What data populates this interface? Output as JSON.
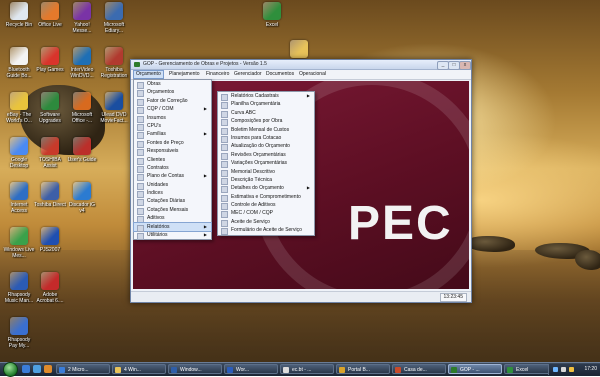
{
  "desktop": {
    "icons": [
      {
        "label": "Recycle Bin",
        "icon": "recycle-bin-icon",
        "color": "#dfe7ef"
      },
      {
        "label": "Office Live",
        "icon": "office-live-icon",
        "color": "#e4792b"
      },
      {
        "label": "Yahoo! Messe...",
        "icon": "yahoo-messenger-icon",
        "color": "#7a33a6"
      },
      {
        "label": "Microsoft Ediary...",
        "icon": "microsoft-ediary-icon",
        "color": "#3b6bb0"
      },
      {
        "label": "Bluetooth Guide Bo...",
        "icon": "bluetooth-icon",
        "color": "#f3f3f3"
      },
      {
        "label": "Play Games",
        "icon": "play-games-icon",
        "color": "#d9342b"
      },
      {
        "label": "InterVideo WinDVD...",
        "icon": "windvd-icon",
        "color": "#1e6fb5"
      },
      {
        "label": "Toshiba Registration",
        "icon": "toshiba-registration-icon",
        "color": "#b13a2f"
      },
      {
        "label": "eBay - The World's O...",
        "icon": "ebay-icon",
        "color": "#e9c43c"
      },
      {
        "label": "Software Upgrades",
        "icon": "software-upgrades-icon",
        "color": "#2d8a3d"
      },
      {
        "label": "Microsoft Office -...",
        "icon": "ms-office-icon",
        "color": "#d86a1f"
      },
      {
        "label": "Ulead DVD MovieFact...",
        "icon": "ulead-icon",
        "color": "#1a4ea0"
      },
      {
        "label": "Google Desktop",
        "icon": "google-desktop-icon",
        "color": "#4a8af4"
      },
      {
        "label": "TOSHIBA Assist",
        "icon": "toshiba-assist-icon",
        "color": "#c83a2a"
      },
      {
        "label": "User's Guide",
        "icon": "users-guide-icon",
        "color": "#bb2f2a"
      },
      {
        "label": "Internet Access",
        "icon": "internet-access-icon",
        "color": "#2e6ec4"
      },
      {
        "label": "Toshiba Direct",
        "icon": "toshiba-direct-icon",
        "color": "#3d5fa8"
      },
      {
        "label": "Discador iG v4",
        "icon": "discador-icon",
        "color": "#2b7bd1"
      },
      {
        "label": "Windows Live Mes...",
        "icon": "windows-live-messenger-icon",
        "color": "#3aa14a"
      },
      {
        "label": "PJS2007",
        "icon": "pjs2007-icon",
        "color": "#1f4fb1"
      },
      {
        "label": "Rhapsody Music Man...",
        "icon": "rhapsody-icon",
        "color": "#2b5bb5"
      },
      {
        "label": "Adobe Acrobat 6....",
        "icon": "adobe-acrobat-icon",
        "color": "#c42a2a"
      },
      {
        "label": "Rhapsody Pay My...",
        "icon": "rhapsody-pay-icon",
        "color": "#3a6fd0"
      },
      {
        "label": "Excel",
        "icon": "excel-icon",
        "color": "#2f8f3c"
      },
      {
        "label": "GOP",
        "icon": "folder-icon",
        "color": "#e8c35a"
      }
    ]
  },
  "window": {
    "title": "GOP - Gerenciamento de Obras e Projetos - Versão 1.5",
    "minimize": "_",
    "maximize": "□",
    "close": "x",
    "menus": [
      "Orçamento",
      "Planejamento",
      "Financeiro",
      "Gerenciador",
      "Documentos",
      "Operacional"
    ],
    "logo_text": "PEC",
    "status_time": "13:23:45"
  },
  "menu_main": {
    "items": [
      {
        "label": "Obras",
        "sub": false
      },
      {
        "label": "Orçamentos",
        "sub": false
      },
      {
        "label": "Fator de Correção",
        "sub": false
      },
      {
        "label": "CQP / COM",
        "sub": true
      },
      {
        "label": "Insumos",
        "sub": false
      },
      {
        "label": "CPU's",
        "sub": false
      },
      {
        "label": "Famílias",
        "sub": true
      },
      {
        "label": "Fontes de Preço",
        "sub": false
      },
      {
        "label": "Responsáveis",
        "sub": false
      },
      {
        "label": "Clientes",
        "sub": false
      },
      {
        "label": "Contratos",
        "sub": false
      },
      {
        "label": "Plano de Contas",
        "sub": true
      },
      {
        "label": "Unidades",
        "sub": false
      },
      {
        "label": "Índices",
        "sub": false
      },
      {
        "label": "Cotações Diárias",
        "sub": false
      },
      {
        "label": "Cotações Mensais",
        "sub": false
      },
      {
        "label": "Aditivos",
        "sub": false
      },
      {
        "label": "Relatórios",
        "sub": true,
        "highlight": true
      },
      {
        "label": "Utilitários",
        "sub": true
      }
    ]
  },
  "menu_sub": {
    "items": [
      {
        "label": "Relatórios Cadastrais",
        "sub": true
      },
      {
        "label": "Planilha Orçamentária",
        "sub": false
      },
      {
        "label": "Curva ABC",
        "sub": false
      },
      {
        "label": "Composições por Obra",
        "sub": false
      },
      {
        "label": "Boletim Mensal de Custos",
        "sub": false
      },
      {
        "label": "Insumos para Cotacao",
        "sub": false
      },
      {
        "label": "Atualização do Orçamento",
        "sub": false
      },
      {
        "label": "Revisões Orçamentárias",
        "sub": false
      },
      {
        "label": "Variações Orçamentárias",
        "sub": false
      },
      {
        "label": "Memorial Descritivo",
        "sub": false
      },
      {
        "label": "Descrição Técnica",
        "sub": false
      },
      {
        "label": "Detalhes do Orçamento",
        "sub": true
      },
      {
        "label": "Estimativa e Comprometimento",
        "sub": false
      },
      {
        "label": "Controle de Aditivos",
        "sub": false
      },
      {
        "label": "MEC / COM / CQP",
        "sub": false
      },
      {
        "label": "Aceite de Serviço",
        "sub": false
      },
      {
        "label": "Formulário de Aceite de Serviço",
        "sub": false
      }
    ]
  },
  "taskbar": {
    "buttons": [
      {
        "label": "2 Micro...",
        "color": "#3b7dd8"
      },
      {
        "label": "4 Win...",
        "color": "#e8c35a"
      },
      {
        "label": "Window...",
        "color": "#2f5ea8"
      },
      {
        "label": "Wor...",
        "color": "#2b5dbb"
      },
      {
        "label": "ec.bt - ...",
        "color": "#dcdcdc"
      },
      {
        "label": "Portal B...",
        "color": "#d9a32b"
      },
      {
        "label": "Casa de...",
        "color": "#c94a2a"
      },
      {
        "label": "GOP - ...",
        "color": "#2d7b2a",
        "active": true
      },
      {
        "label": "Excel",
        "color": "#2f8f3c"
      }
    ],
    "clock": "17:20"
  }
}
